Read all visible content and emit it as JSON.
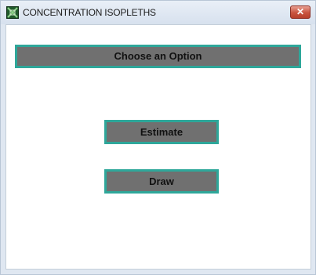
{
  "window": {
    "title": "CONCENTRATION ISOPLETHS",
    "app_icon": "isopleth-app-icon",
    "close_icon": "close-icon",
    "close_glyph": "✕"
  },
  "main": {
    "header_label": "Choose an Option",
    "buttons": [
      {
        "label": "Estimate"
      },
      {
        "label": "Draw"
      }
    ]
  },
  "colors": {
    "button_fill": "#707070",
    "button_border": "#2ea79a",
    "close_button": "#c9543f",
    "background": "#ffffff"
  }
}
